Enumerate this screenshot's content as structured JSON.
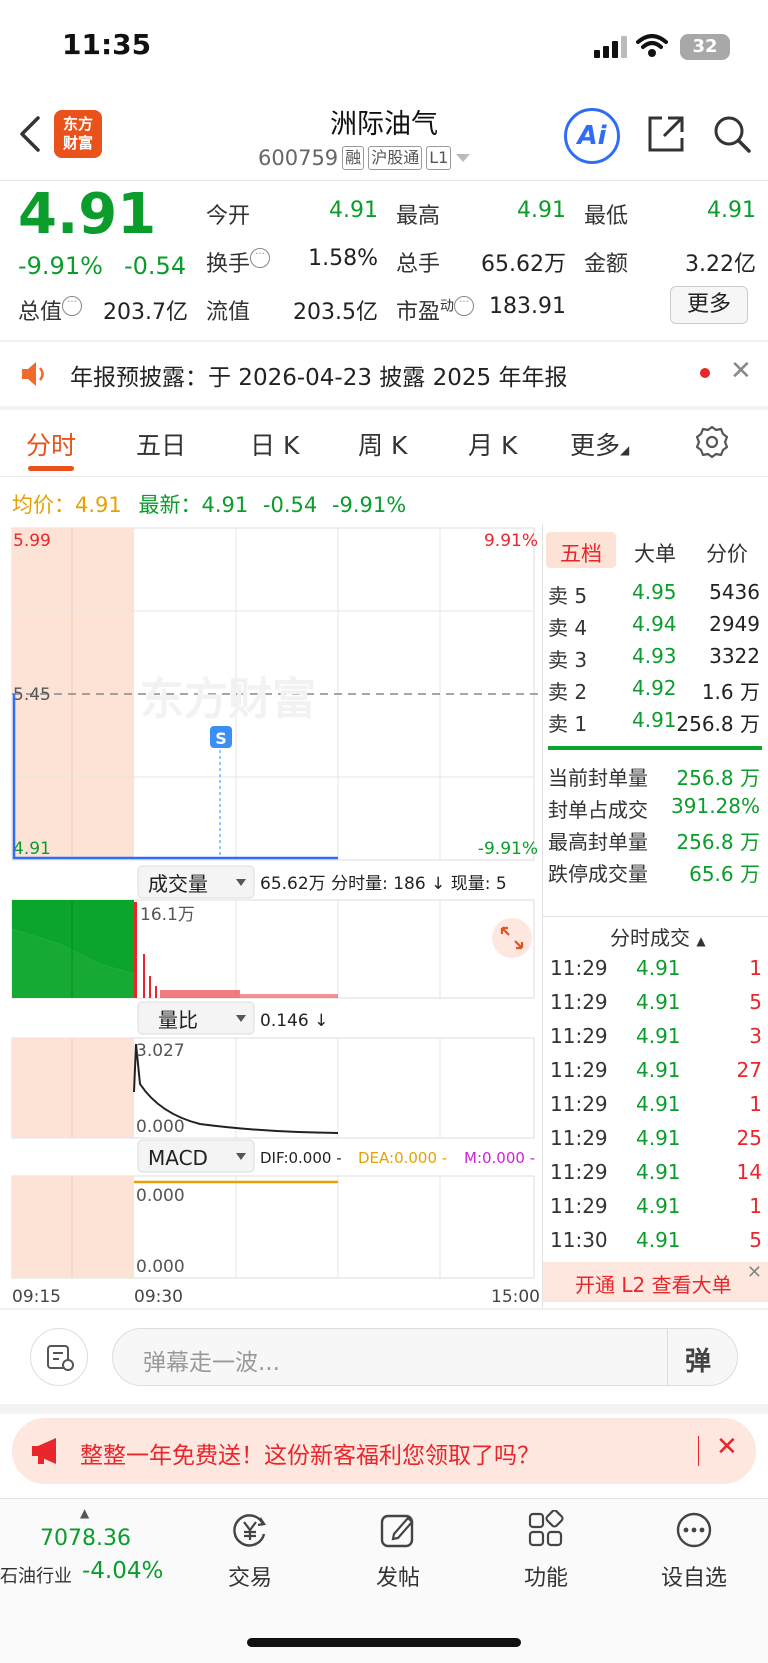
{
  "status": {
    "time": "11:35",
    "battery": "32"
  },
  "header": {
    "logo": "东方财富",
    "logo_line1": "东方",
    "logo_line2": "财富",
    "name": "洲际油气",
    "code": "600759",
    "tags": [
      "融",
      "沪股通",
      "L1"
    ],
    "ai_label": "Ai"
  },
  "quote": {
    "price": "4.91",
    "pct": "-9.91%",
    "change": "-0.54",
    "open_label": "今开",
    "open": "4.91",
    "high_label": "最高",
    "high": "4.91",
    "low_label": "最低",
    "low": "4.91",
    "turnover_label": "换手",
    "turnover": "1.58%",
    "volume_label": "总手",
    "volume": "65.62万",
    "amount_label": "金额",
    "amount": "3.22亿",
    "mktcap_label": "总值",
    "mktcap": "203.7亿",
    "float_label": "流值",
    "float": "203.5亿",
    "pe_label": "市盈",
    "pe_sup": "动",
    "pe": "183.91",
    "more": "更多"
  },
  "notice": {
    "text": "年报预披露：于 2026-04-23 披露 2025 年年报"
  },
  "tabs": [
    "分时",
    "五日",
    "日 K",
    "周 K",
    "月 K",
    "更多"
  ],
  "summary": {
    "avg_label": "均价：",
    "avg": "4.91",
    "latest_label": "最新：",
    "latest": "4.91",
    "chg": "-0.54",
    "pct": "-9.91%"
  },
  "chart": {
    "y_top": "5.99",
    "y_mid": "5.45",
    "y_bottom": "4.91",
    "pct_top": "9.91%",
    "pct_bottom": "-9.91%",
    "watermark": "东方财富",
    "marker": "S",
    "vol_selector": "成交量",
    "vol_info": "65.62万 分时量: 186 ↓ 现量: 5",
    "vol_peak": "16.1万",
    "ratio_selector": "量比",
    "ratio_info": "0.146 ↓",
    "ratio_top": "3.027",
    "ratio_bottom": "0.000",
    "macd_selector": "MACD",
    "dif": "DIF:0.000 -",
    "dea": "DEA:0.000 -",
    "m": "M:0.000 -",
    "macd_top": "0.000",
    "macd_bottom": "0.000",
    "t_start": "09:15",
    "t_open": "09:30",
    "t_end": "15:00"
  },
  "orderbook": {
    "tabs": [
      "五档",
      "大单",
      "分价"
    ],
    "asks": [
      {
        "label": "卖 5",
        "price": "4.95",
        "vol": "5436"
      },
      {
        "label": "卖 4",
        "price": "4.94",
        "vol": "2949"
      },
      {
        "label": "卖 3",
        "price": "4.93",
        "vol": "3322"
      },
      {
        "label": "卖 2",
        "price": "4.92",
        "vol": "1.6 万"
      },
      {
        "label": "卖 1",
        "price": "4.91",
        "vol": "256.8 万"
      }
    ],
    "stats": [
      {
        "label": "当前封单量",
        "value": "256.8 万"
      },
      {
        "label": "封单占成交",
        "value": "391.28%"
      },
      {
        "label": "最高封单量",
        "value": "256.8 万"
      },
      {
        "label": "跌停成交量",
        "value": "65.6 万"
      }
    ],
    "ticks_title": "分时成交",
    "ticks": [
      {
        "t": "11:29",
        "p": "4.91",
        "v": "1"
      },
      {
        "t": "11:29",
        "p": "4.91",
        "v": "5"
      },
      {
        "t": "11:29",
        "p": "4.91",
        "v": "3"
      },
      {
        "t": "11:29",
        "p": "4.91",
        "v": "27"
      },
      {
        "t": "11:29",
        "p": "4.91",
        "v": "1"
      },
      {
        "t": "11:29",
        "p": "4.91",
        "v": "25"
      },
      {
        "t": "11:29",
        "p": "4.91",
        "v": "14"
      },
      {
        "t": "11:29",
        "p": "4.91",
        "v": "1"
      },
      {
        "t": "11:30",
        "p": "4.91",
        "v": "5"
      }
    ],
    "l2_promo": "开通 L2 查看大单"
  },
  "danmu": {
    "placeholder": "弹幕走一波...",
    "send": "弹"
  },
  "ad": {
    "text": "整整一年免费送！这份新客福利您领取了吗？"
  },
  "tabbar": {
    "index_value": "7078.36",
    "index_name": "石油行业",
    "index_pct": "-4.04%",
    "items": [
      "交易",
      "发帖",
      "功能",
      "设自选"
    ]
  }
}
